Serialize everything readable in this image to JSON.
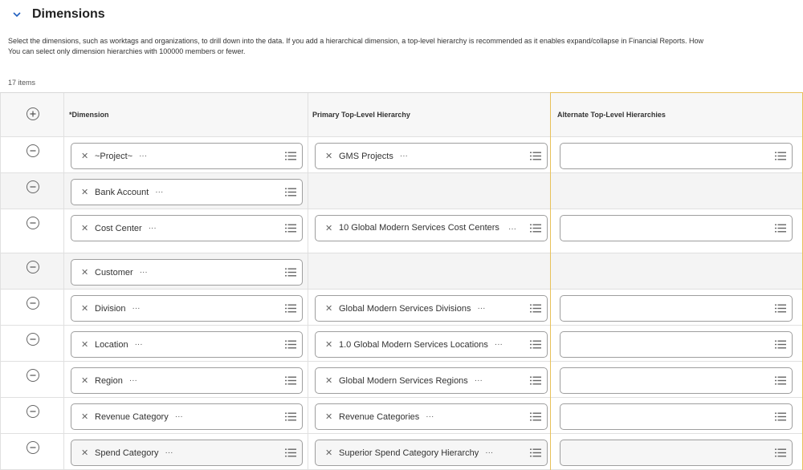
{
  "section": {
    "title": "Dimensions",
    "description_line1": "Select the dimensions, such as worktags and organizations, to drill down into the data. If you add a hierarchical dimension, a top-level hierarchy is recommended as it enables expand/collapse in Financial Reports. How",
    "description_line2": "You can select only dimension hierarchies with 100000  members or fewer.",
    "item_count": "17 items"
  },
  "table": {
    "columns": [
      "*Dimension",
      "Primary Top-Level Hierarchy",
      "Alternate Top-Level Hierarchies"
    ],
    "rows": [
      {
        "dimension": "~Project~",
        "primary": "GMS Projects",
        "alternate": true
      },
      {
        "dimension": "Bank Account",
        "primary": "",
        "alternate": false
      },
      {
        "dimension": "Cost Center",
        "primary": "10 Global Modern Services Cost Centers",
        "alternate": true
      },
      {
        "dimension": "Customer",
        "primary": "",
        "alternate": false
      },
      {
        "dimension": "Division",
        "primary": "Global Modern Services Divisions",
        "alternate": true
      },
      {
        "dimension": "Location",
        "primary": "1.0 Global Modern Services Locations",
        "alternate": true
      },
      {
        "dimension": "Region",
        "primary": "Global Modern Services Regions",
        "alternate": true
      },
      {
        "dimension": "Revenue Category",
        "primary": "Revenue Categories",
        "alternate": true
      },
      {
        "dimension": "Spend Category",
        "primary": "Superior Spend Category Hierarchy",
        "alternate": true
      }
    ]
  },
  "icons": {
    "collapse": "chevron-down-icon",
    "add_row": "plus-circle-icon",
    "remove_row": "minus-circle-icon",
    "clear": "close-icon",
    "more": "more-dots-icon",
    "prompt": "list-icon"
  },
  "glyphs": {
    "clear": "✕",
    "more": "···"
  },
  "colors": {
    "accent": "#1f5fbf",
    "highlight_border": "#e8c15a"
  }
}
